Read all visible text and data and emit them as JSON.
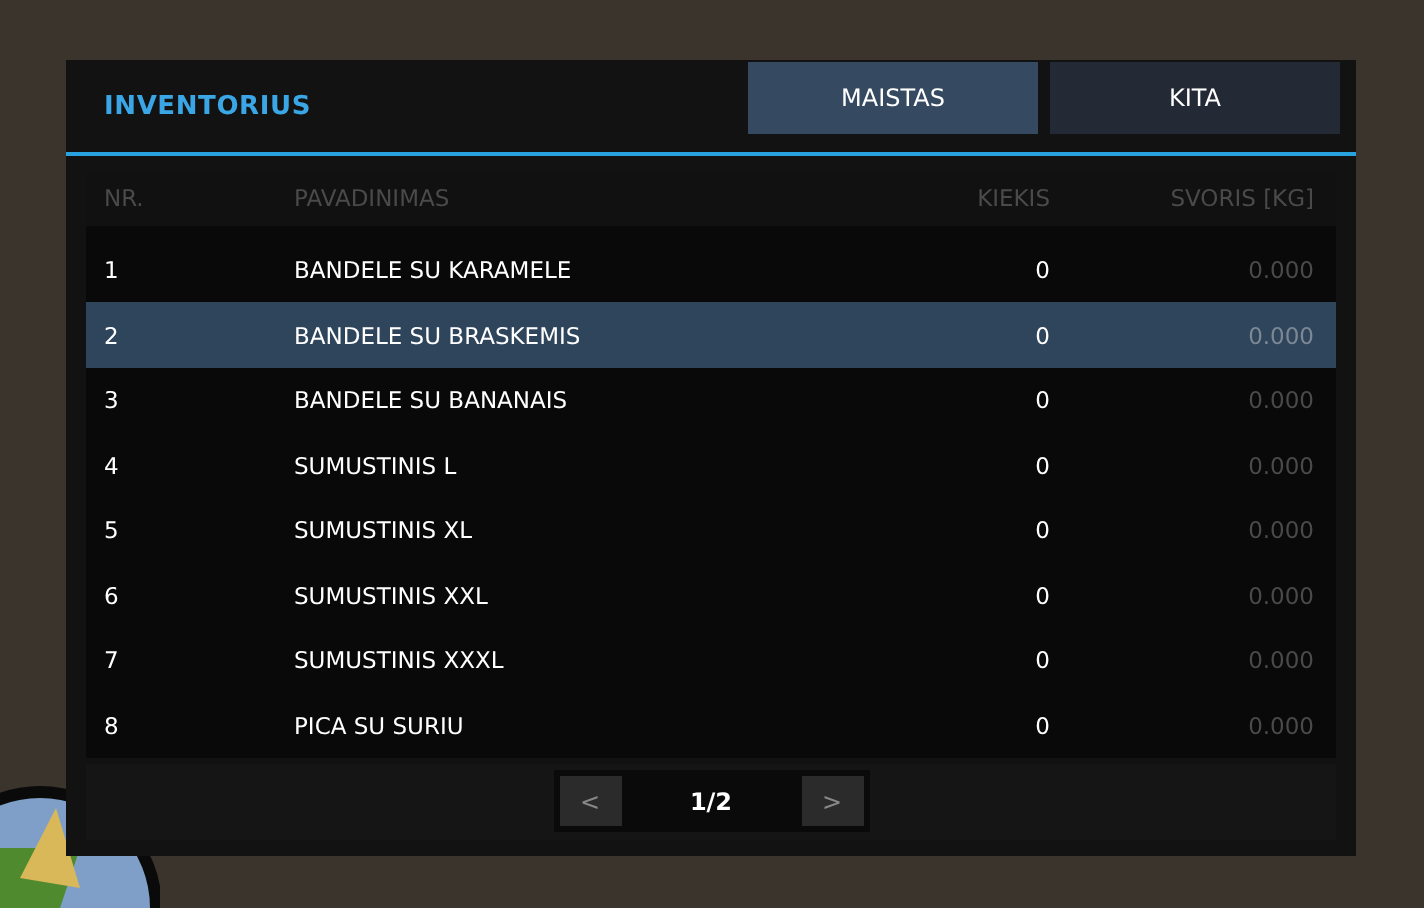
{
  "window": {
    "title": "INVENTORIUS"
  },
  "tabs": [
    {
      "label": "MAISTAS",
      "selected": true
    },
    {
      "label": "KITA",
      "selected": false
    }
  ],
  "table": {
    "columns": [
      "NR.",
      "PAVADINIMAS",
      "KIEKIS",
      "SVORIS [KG]"
    ],
    "rows": [
      {
        "cells": [
          "1",
          "BANDELE SU KARAMELE",
          "0",
          "0.000"
        ],
        "selected": false
      },
      {
        "cells": [
          "2",
          "BANDELE SU BRASKEMIS",
          "0",
          "0.000"
        ],
        "selected": true
      },
      {
        "cells": [
          "3",
          "BANDELE SU BANANAIS",
          "0",
          "0.000"
        ],
        "selected": false
      },
      {
        "cells": [
          "4",
          "SUMUSTINIS L",
          "0",
          "0.000"
        ],
        "selected": false
      },
      {
        "cells": [
          "5",
          "SUMUSTINIS XL",
          "0",
          "0.000"
        ],
        "selected": false
      },
      {
        "cells": [
          "6",
          "SUMUSTINIS XXL",
          "0",
          "0.000"
        ],
        "selected": false
      },
      {
        "cells": [
          "7",
          "SUMUSTINIS XXXL",
          "0",
          "0.000"
        ],
        "selected": false
      },
      {
        "cells": [
          "8",
          "PICA SU SURIU",
          "0",
          "0.000"
        ],
        "selected": false
      }
    ]
  },
  "pagination": {
    "prev": "<",
    "page": "1/2",
    "next": ">"
  }
}
